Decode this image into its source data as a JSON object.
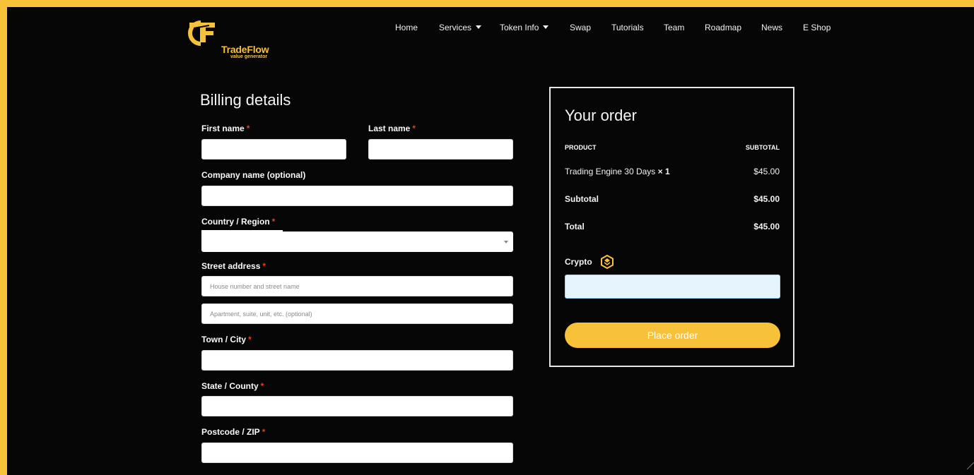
{
  "colors": {
    "frame": "#f8c13a",
    "accent": "#f8c13a",
    "background": "#060606",
    "required": "#e2401c"
  },
  "brand": {
    "name": "TradeFlow",
    "tagline": "value generator",
    "logo_icon": "tradeflow-tf-logo"
  },
  "nav": {
    "items": [
      {
        "label": "Home",
        "has_dropdown": false
      },
      {
        "label": "Services",
        "has_dropdown": true
      },
      {
        "label": "Token Info",
        "has_dropdown": true
      },
      {
        "label": "Swap",
        "has_dropdown": false
      },
      {
        "label": "Tutorials",
        "has_dropdown": false
      },
      {
        "label": "Team",
        "has_dropdown": false
      },
      {
        "label": "Roadmap",
        "has_dropdown": false
      },
      {
        "label": "News",
        "has_dropdown": false
      },
      {
        "label": "E Shop",
        "has_dropdown": false
      }
    ]
  },
  "billing": {
    "title": "Billing details",
    "required_mark": "*",
    "first_name": {
      "label": "First name",
      "value": ""
    },
    "last_name": {
      "label": "Last name",
      "value": ""
    },
    "company": {
      "label": "Company name (optional)",
      "value": ""
    },
    "country": {
      "label": "Country / Region",
      "value": ""
    },
    "street": {
      "label": "Street address",
      "line1_placeholder": "House number and street name",
      "line2_placeholder": "Apartment, suite, unit, etc. (optional)"
    },
    "city": {
      "label": "Town / City",
      "value": ""
    },
    "state": {
      "label": "State / County",
      "value": ""
    },
    "postcode": {
      "label": "Postcode / ZIP",
      "value": ""
    }
  },
  "order": {
    "title": "Your order",
    "col_product": "PRODUCT",
    "col_subtotal": "SUBTOTAL",
    "item_name": "Trading Engine 30 Days",
    "item_qty": "× 1",
    "item_price": "$45.00",
    "subtotal_label": "Subtotal",
    "subtotal_value": "$45.00",
    "total_label": "Total",
    "total_value": "$45.00",
    "payment_method": "Crypto",
    "payment_icon": "bnb-coin-icon",
    "place_order": "Place order"
  }
}
